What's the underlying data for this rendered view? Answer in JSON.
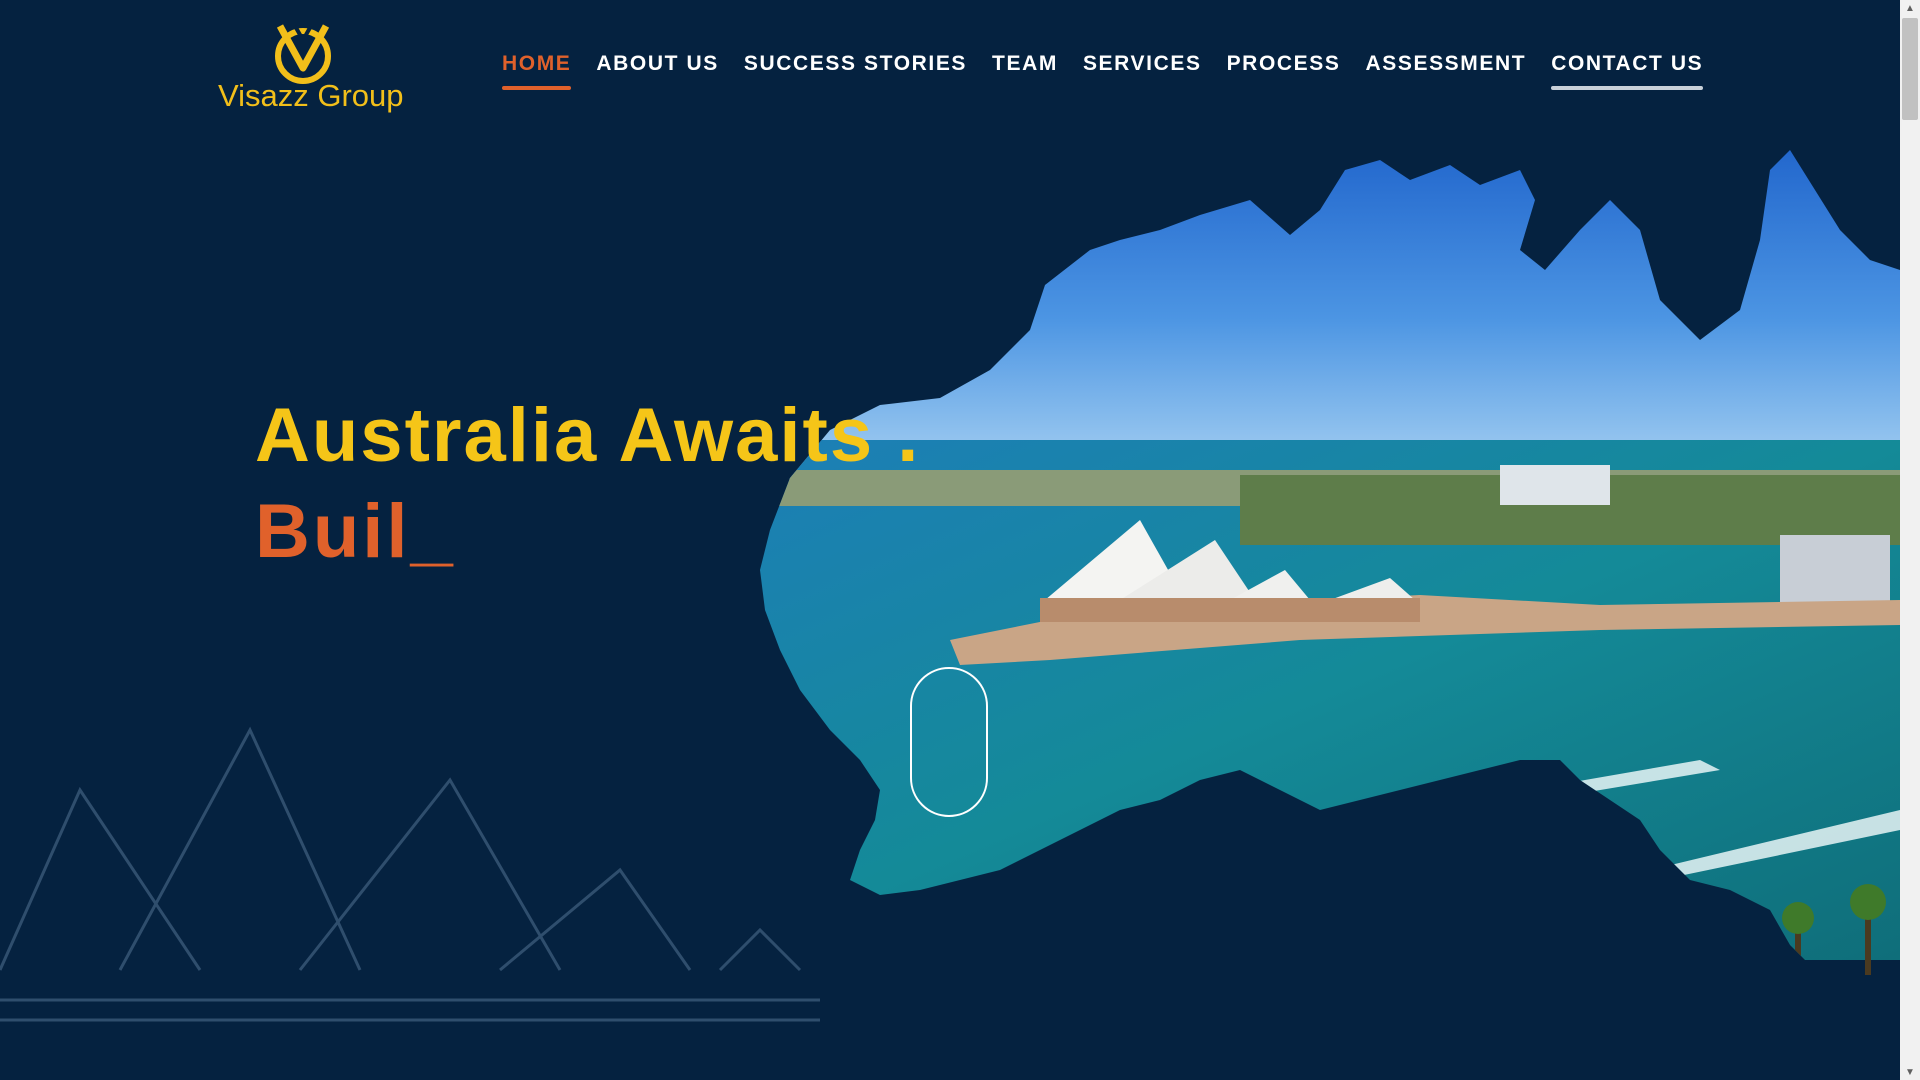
{
  "brand": {
    "name": "Visazz Group",
    "color": "#f2bf1a"
  },
  "nav": {
    "items": [
      {
        "label": "HOME",
        "state": "active"
      },
      {
        "label": "ABOUT US"
      },
      {
        "label": "SUCCESS STORIES"
      },
      {
        "label": "TEAM"
      },
      {
        "label": "SERVICES"
      },
      {
        "label": "PROCESS"
      },
      {
        "label": "ASSESSMENT"
      },
      {
        "label": "CONTACT US",
        "state": "underlined"
      }
    ]
  },
  "hero": {
    "headline": "Australia Awaits .",
    "typed_text": "Buil_",
    "headline_color": "#f5c518",
    "typed_color": "#e0612b",
    "background_image": "australia-map-sydney-opera-house-photo",
    "scroll_indicator_icon": "mouse-scroll-icon"
  },
  "colors": {
    "background": "#052240",
    "accent": "#e0612b",
    "highlight": "#f5c518"
  },
  "scrollbar": {
    "icons": [
      "arrow-up-icon",
      "arrow-down-icon"
    ]
  }
}
